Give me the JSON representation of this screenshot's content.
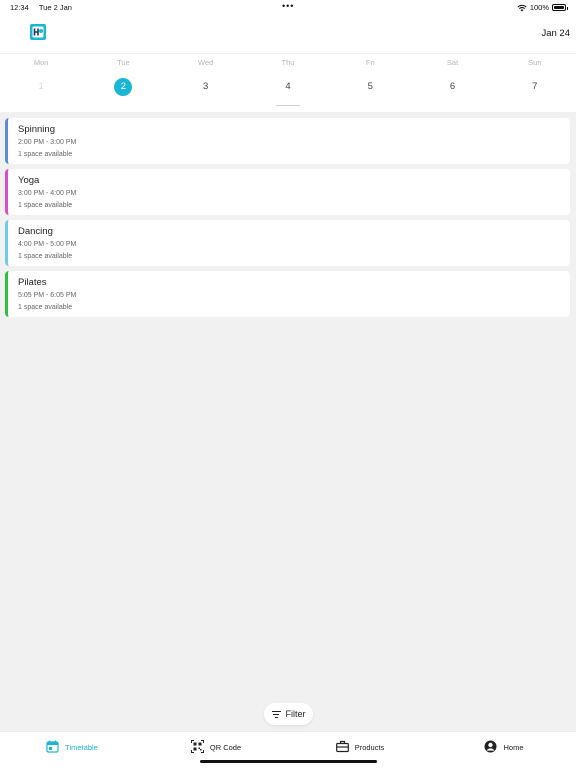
{
  "status_bar": {
    "time": "12:34",
    "date": "Tue 2 Jan",
    "dots": "•••",
    "battery": "100%"
  },
  "header": {
    "logo_text": "H",
    "month_label": "Jan 24"
  },
  "week": [
    {
      "name": "Mon",
      "num": "1",
      "state": "past"
    },
    {
      "name": "Tue",
      "num": "2",
      "state": "selected"
    },
    {
      "name": "Wed",
      "num": "3",
      "state": "normal"
    },
    {
      "name": "Thu",
      "num": "4",
      "state": "today"
    },
    {
      "name": "Fri",
      "num": "5",
      "state": "normal"
    },
    {
      "name": "Sat",
      "num": "6",
      "state": "normal"
    },
    {
      "name": "Sun",
      "num": "7",
      "state": "normal"
    }
  ],
  "classes": [
    {
      "name": "Spinning",
      "time": "2:00 PM - 3:00 PM",
      "availability": "1 space available",
      "color": "#5b8bd9"
    },
    {
      "name": "Yoga",
      "time": "3:00 PM - 4:00 PM",
      "availability": "1 space available",
      "color": "#d94fc9"
    },
    {
      "name": "Dancing",
      "time": "4:00 PM - 5:00 PM",
      "availability": "1 space available",
      "color": "#6fcbe8"
    },
    {
      "name": "Pilates",
      "time": "5:05 PM - 6:05 PM",
      "availability": "1 space available",
      "color": "#2fbf3f"
    }
  ],
  "filter": {
    "label": "Filter",
    "icon": "filter-icon"
  },
  "tabs": [
    {
      "label": "Timetable",
      "icon": "calendar-icon",
      "active": true
    },
    {
      "label": "QR Code",
      "icon": "qr-code-icon",
      "active": false
    },
    {
      "label": "Products",
      "icon": "briefcase-icon",
      "active": false
    },
    {
      "label": "Home",
      "icon": "user-circle-icon",
      "active": false
    }
  ],
  "colors": {
    "accent": "#1ab6d4"
  }
}
